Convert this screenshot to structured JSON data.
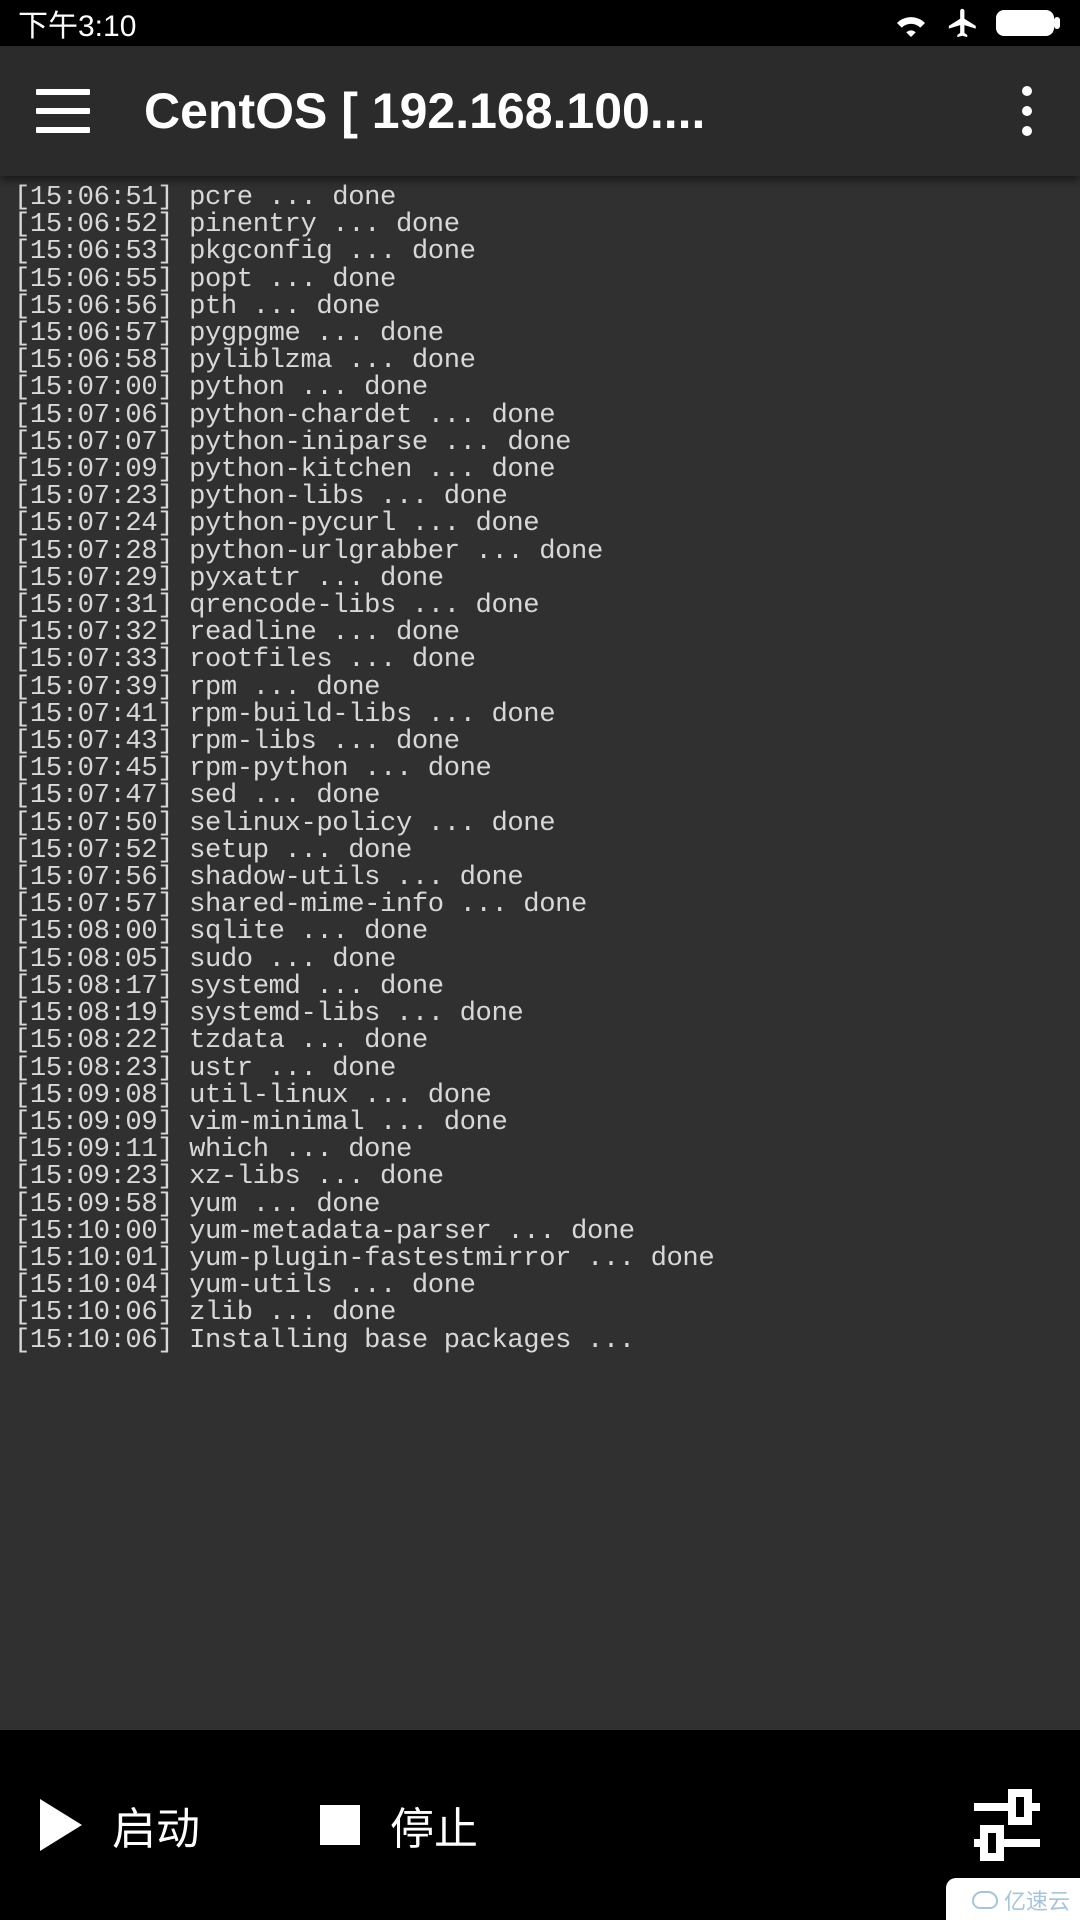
{
  "status_bar": {
    "time": "下午3:10"
  },
  "header": {
    "title": "CentOS  [ 192.168.100...."
  },
  "terminal": {
    "lines": [
      "[15:06:51] pcre ... done",
      "[15:06:52] pinentry ... done",
      "[15:06:53] pkgconfig ... done",
      "[15:06:55] popt ... done",
      "[15:06:56] pth ... done",
      "[15:06:57] pygpgme ... done",
      "[15:06:58] pyliblzma ... done",
      "[15:07:00] python ... done",
      "[15:07:06] python-chardet ... done",
      "[15:07:07] python-iniparse ... done",
      "[15:07:09] python-kitchen ... done",
      "[15:07:23] python-libs ... done",
      "[15:07:24] python-pycurl ... done",
      "[15:07:28] python-urlgrabber ... done",
      "[15:07:29] pyxattr ... done",
      "[15:07:31] qrencode-libs ... done",
      "[15:07:32] readline ... done",
      "[15:07:33] rootfiles ... done",
      "[15:07:39] rpm ... done",
      "[15:07:41] rpm-build-libs ... done",
      "[15:07:43] rpm-libs ... done",
      "[15:07:45] rpm-python ... done",
      "[15:07:47] sed ... done",
      "[15:07:50] selinux-policy ... done",
      "[15:07:52] setup ... done",
      "[15:07:56] shadow-utils ... done",
      "[15:07:57] shared-mime-info ... done",
      "[15:08:00] sqlite ... done",
      "[15:08:05] sudo ... done",
      "[15:08:17] systemd ... done",
      "[15:08:19] systemd-libs ... done",
      "[15:08:22] tzdata ... done",
      "[15:08:23] ustr ... done",
      "[15:09:08] util-linux ... done",
      "[15:09:09] vim-minimal ... done",
      "[15:09:11] which ... done",
      "[15:09:23] xz-libs ... done",
      "[15:09:58] yum ... done",
      "[15:10:00] yum-metadata-parser ... done",
      "[15:10:01] yum-plugin-fastestmirror ... done",
      "[15:10:04] yum-utils ... done",
      "[15:10:06] zlib ... done",
      "[15:10:06] Installing base packages ..."
    ]
  },
  "bottom_bar": {
    "start_label": "启动",
    "stop_label": "停止"
  },
  "watermark": {
    "text": "亿速云"
  }
}
